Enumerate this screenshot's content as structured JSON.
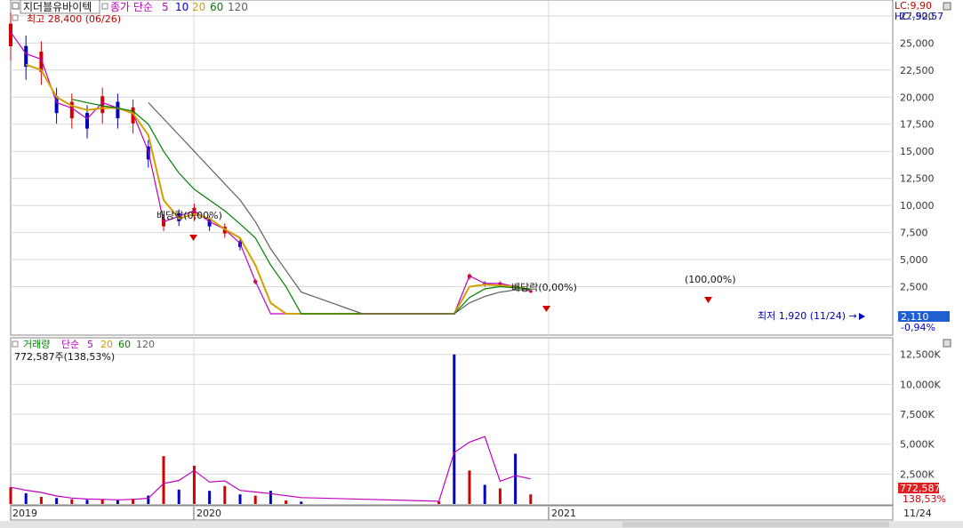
{
  "stock": {
    "name": "지더블유바이텍",
    "ma_label": "종가 단순",
    "ma_periods": [
      "5",
      "10",
      "20",
      "60",
      "120"
    ],
    "ma_colors": [
      "#c000c0",
      "#0000d0",
      "#d4a000",
      "#008000",
      "#606060"
    ],
    "high_marker": "최고 28,400 (06/26)",
    "low_marker": "최저 1,920 (11/24) →",
    "lc": "LC:9,90",
    "hc": "HC:-92,57",
    "last_price": "2,110",
    "last_change": "-0,94%",
    "annotations": [
      "배당락(0,00%)",
      "배당락(0,00%)",
      "(100,00%)"
    ]
  },
  "volume": {
    "title": "거래량",
    "ma_label": "단순",
    "ma_periods": [
      "5",
      "20",
      "60",
      "120"
    ],
    "ma_colors": [
      "#c000c0",
      "#d4a000",
      "#008000",
      "#606060"
    ],
    "current": "772,587주(138,53%)",
    "last_value": "772,587",
    "last_pct": "138,53%"
  },
  "x_axis": {
    "labels": [
      "2019",
      "2020",
      "2021"
    ],
    "last_date": "11/24"
  },
  "chart_data": [
    {
      "type": "line",
      "title": "지더블유바이텍",
      "y_ticks": [
        "27,500",
        "25,000",
        "22,500",
        "20,000",
        "17,500",
        "15,000",
        "12,500",
        "10,000",
        "7,500",
        "5,000",
        "2,500"
      ],
      "ylim": [
        0,
        28000
      ],
      "x": [
        "2019-01",
        "2019-02",
        "2019-03",
        "2019-04",
        "2019-05",
        "2019-06",
        "2019-07",
        "2019-08",
        "2019-09",
        "2019-10",
        "2019-11",
        "2019-12",
        "2020-01",
        "2020-02",
        "2020-03",
        "2020-04",
        "2020-05",
        "2020-06",
        "2020-07",
        "2020-08",
        "2020-12",
        "2021-01",
        "2021-05",
        "2021-06",
        "2021-07",
        "2021-08",
        "2021-09",
        "2021-10",
        "2021-11"
      ],
      "series": [
        {
          "name": "5",
          "values": [
            26000,
            24000,
            23500,
            19500,
            19000,
            18000,
            19500,
            19000,
            18500,
            15000,
            8500,
            9000,
            9500,
            8500,
            7800,
            6500,
            3000,
            0,
            0,
            0,
            0,
            0,
            0,
            0,
            3500,
            2800,
            2800,
            2500,
            2100
          ]
        },
        {
          "name": "20",
          "values": [
            null,
            23000,
            22500,
            20000,
            19200,
            18800,
            19000,
            19000,
            18500,
            16500,
            10500,
            8800,
            9200,
            8800,
            7800,
            7000,
            4500,
            1000,
            0,
            0,
            0,
            0,
            0,
            0,
            2500,
            2700,
            2600,
            2500,
            2200
          ]
        },
        {
          "name": "60",
          "values": [
            null,
            null,
            null,
            null,
            19800,
            19500,
            19200,
            19000,
            18700,
            17500,
            15000,
            13000,
            11500,
            10500,
            9500,
            8300,
            7000,
            4500,
            2500,
            0,
            0,
            0,
            0,
            0,
            1500,
            2300,
            2500,
            2400,
            2300
          ]
        },
        {
          "name": "120",
          "values": [
            null,
            null,
            null,
            null,
            null,
            null,
            null,
            null,
            null,
            19500,
            18000,
            16500,
            15000,
            13500,
            12000,
            10500,
            8500,
            6000,
            4000,
            2000,
            0,
            0,
            0,
            0,
            1000,
            1600,
            2000,
            2200,
            2200
          ]
        }
      ]
    },
    {
      "type": "bar",
      "title": "거래량",
      "y_ticks": [
        "12,500K",
        "10,000K",
        "7,500K",
        "5,000K",
        "2,500K"
      ],
      "ylim": [
        0,
        13000
      ],
      "x": [
        "2019-01",
        "2019-02",
        "2019-03",
        "2019-04",
        "2019-05",
        "2019-06",
        "2019-07",
        "2019-08",
        "2019-09",
        "2019-10",
        "2019-11",
        "2019-12",
        "2020-01",
        "2020-02",
        "2020-03",
        "2020-04",
        "2020-05",
        "2020-06",
        "2020-07",
        "2020-08",
        "2021-05",
        "2021-06",
        "2021-07",
        "2021-08",
        "2021-09",
        "2021-10",
        "2021-11"
      ],
      "values": [
        1400,
        900,
        600,
        500,
        400,
        350,
        400,
        300,
        450,
        700,
        4000,
        1200,
        3200,
        1100,
        1500,
        800,
        700,
        1100,
        300,
        200,
        200,
        12500,
        2800,
        1600,
        1300,
        4200,
        800
      ]
    }
  ]
}
